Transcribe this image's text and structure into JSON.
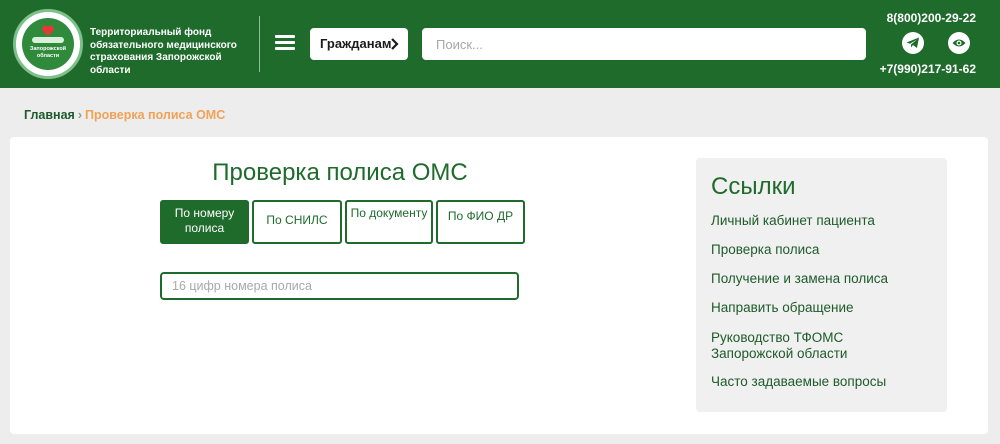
{
  "header": {
    "logo_text": "Запорожской области",
    "org_name": "Территориальный фонд обязательного медицинского страхования Запорожской области",
    "citizens_button": "Гражданам",
    "search_placeholder": "Поиск...",
    "phone_1": "8(800)200-29-22",
    "phone_2": "+7(990)217-91-62",
    "icons": [
      "menu-icon",
      "telegram-icon",
      "eye-icon",
      "chevron-right-icon"
    ],
    "brand_color": "#1e6b2c"
  },
  "breadcrumb": {
    "home": "Главная",
    "current": "Проверка полиса ОМС"
  },
  "main": {
    "title": "Проверка полиса ОМС",
    "tabs": [
      {
        "label": "По номеру полиса",
        "active": true
      },
      {
        "label": "По СНИЛС",
        "active": false
      },
      {
        "label": "По документу",
        "active": false
      },
      {
        "label": "По ФИО ДР",
        "active": false
      }
    ],
    "input_placeholder": "16 цифр номера полиса"
  },
  "sidebar": {
    "title": "Ссылки",
    "links": [
      "Личный кабинет пациента",
      "Проверка полиса",
      "Получение и замена полиса",
      "Направить обращение",
      "Руководство ТФОМС Запорожской области",
      "Часто задаваемые вопросы"
    ]
  }
}
